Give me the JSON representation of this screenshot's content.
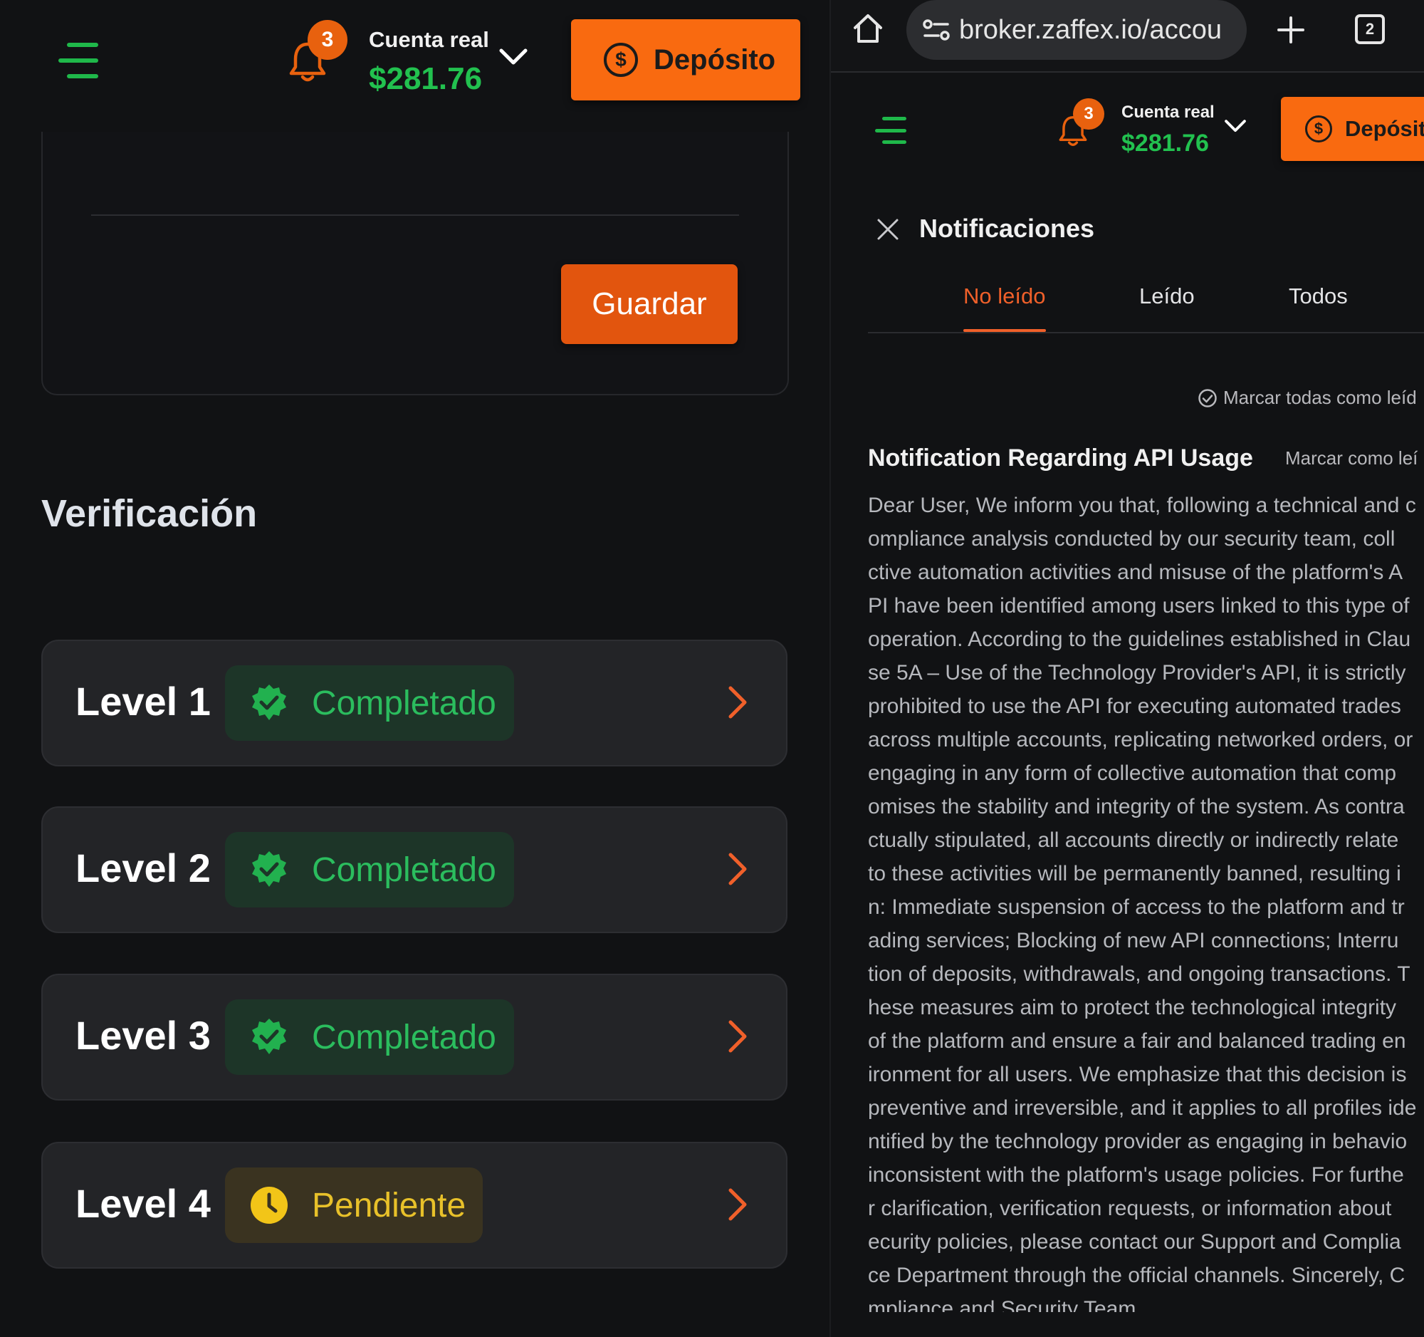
{
  "header": {
    "notification_count": "3",
    "account_label": "Cuenta real",
    "balance": "$281.76",
    "deposit_label": "Depósito",
    "deposit_label_truncated": "Depósit",
    "deposit_icon_symbol": "$"
  },
  "form": {
    "save_label": "Guardar"
  },
  "verification": {
    "title": "Verificación",
    "levels": [
      {
        "name": "Level 1",
        "status": "Completado",
        "state": "completed"
      },
      {
        "name": "Level 2",
        "status": "Completado",
        "state": "completed"
      },
      {
        "name": "Level 3",
        "status": "Completado",
        "state": "completed"
      },
      {
        "name": "Level 4",
        "status": "Pendiente",
        "state": "pending"
      }
    ]
  },
  "browser": {
    "url": "broker.zaffex.io/accou",
    "tab_count": "2"
  },
  "notifications": {
    "title": "Notificaciones",
    "tabs": [
      "No leído",
      "Leído",
      "Todos"
    ],
    "active_tab": "No leído",
    "mark_all_label": "Marcar todas como leíd",
    "item": {
      "title": "Notification Regarding API Usage",
      "mark_read_label": "Marcar como leí",
      "body_lines": [
        "Dear User, We inform you that, following a technical and c",
        "ompliance analysis conducted by our security team, coll",
        "ctive automation activities and misuse of the platform's A",
        "PI have been identified among users linked to this type of",
        "operation. According to the guidelines established in Clau",
        "se 5A – Use of the Technology Provider's API, it is strictly",
        "prohibited to use the API for executing automated trades",
        "across multiple accounts, replicating networked orders, or",
        "engaging in any form of collective automation that comp",
        "omises the stability and integrity of the system. As contra",
        "ctually stipulated, all accounts directly or indirectly relate",
        "to these activities will be permanently banned, resulting i",
        "n: Immediate suspension of access to the platform and tr",
        "ading services; Blocking of new API connections; Interru",
        "tion of deposits, withdrawals, and ongoing transactions. T",
        "hese measures aim to protect the technological integrity",
        "of the platform and ensure a fair and balanced trading en",
        "ironment for all users. We emphasize that this decision is",
        "preventive and irreversible, and it applies to all profiles ide",
        "ntified by the technology provider as engaging in behavio",
        "inconsistent with the platform's usage policies. For furthe",
        "r clarification, verification requests, or information about",
        "ecurity policies, please contact our Support and Complia",
        "ce Department through the official channels. Sincerely, C",
        "mpliance and Security Team"
      ]
    }
  },
  "colors": {
    "accent_orange": "#f96a10",
    "balance_green": "#22c14f",
    "completed_green": "#2bbd5e",
    "pending_yellow": "#e8c12a",
    "background": "#111214"
  }
}
